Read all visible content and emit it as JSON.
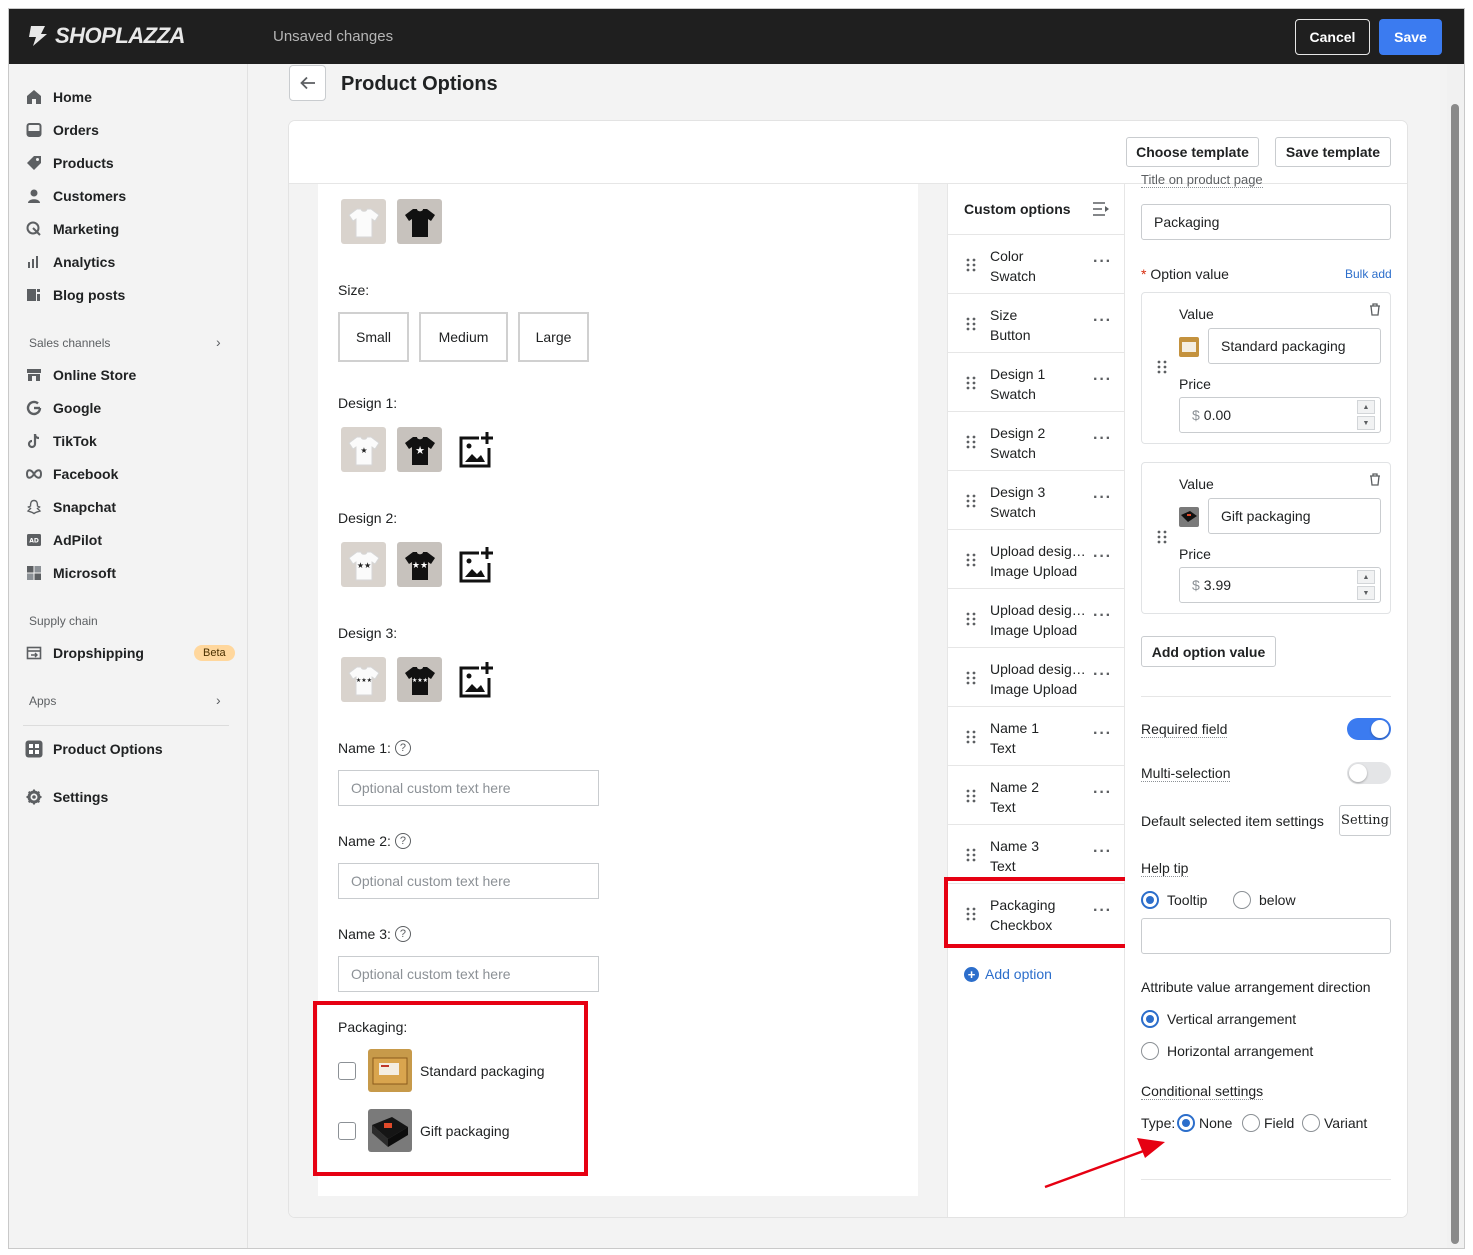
{
  "topbar": {
    "logo_text": "SHOPLAZZA",
    "status_text": "Unsaved changes",
    "cancel_label": "Cancel",
    "save_label": "Save",
    "accent_color": "#3b7bf0"
  },
  "sidebar": {
    "items": [
      {
        "label": "Home",
        "icon": "home-icon"
      },
      {
        "label": "Orders",
        "icon": "orders-icon"
      },
      {
        "label": "Products",
        "icon": "tag-icon"
      },
      {
        "label": "Customers",
        "icon": "person-icon"
      },
      {
        "label": "Marketing",
        "icon": "marketing-icon"
      },
      {
        "label": "Analytics",
        "icon": "analytics-icon"
      },
      {
        "label": "Blog posts",
        "icon": "blog-icon"
      }
    ],
    "sales_channels_label": "Sales channels",
    "channels": [
      {
        "label": "Online Store",
        "icon": "store-icon"
      },
      {
        "label": "Google",
        "icon": "google-icon"
      },
      {
        "label": "TikTok",
        "icon": "tiktok-icon"
      },
      {
        "label": "Facebook",
        "icon": "facebook-icon"
      },
      {
        "label": "Snapchat",
        "icon": "snapchat-icon"
      },
      {
        "label": "AdPilot",
        "icon": "adpilot-icon"
      },
      {
        "label": "Microsoft",
        "icon": "microsoft-icon"
      }
    ],
    "supply_chain_label": "Supply chain",
    "dropshipping_label": "Dropshipping",
    "beta_label": "Beta",
    "apps_label": "Apps",
    "product_options_label": "Product Options",
    "settings_label": "Settings"
  },
  "header": {
    "page_title": "Product Options",
    "choose_template_label": "Choose template",
    "save_template_label": "Save template"
  },
  "preview": {
    "size_label": "Size:",
    "size_options": [
      "Small",
      "Medium",
      "Large"
    ],
    "design1_label": "Design 1:",
    "design2_label": "Design 2:",
    "design3_label": "Design 3:",
    "name1_label": "Name 1:",
    "name2_label": "Name 2:",
    "name3_label": "Name 3:",
    "name_placeholder": "Optional custom text here",
    "packaging_label": "Packaging:",
    "packaging_options": [
      "Standard packaging",
      "Gift packaging"
    ]
  },
  "custom_options": {
    "title": "Custom options",
    "items": [
      {
        "name": "Color",
        "type": "Swatch"
      },
      {
        "name": "Size",
        "type": "Button"
      },
      {
        "name": "Design 1",
        "type": "Swatch"
      },
      {
        "name": "Design 2",
        "type": "Swatch"
      },
      {
        "name": "Design 3",
        "type": "Swatch"
      },
      {
        "name": "Upload design...",
        "type": "Image Upload"
      },
      {
        "name": "Upload design...",
        "type": "Image Upload"
      },
      {
        "name": "Upload design...",
        "type": "Image Upload"
      },
      {
        "name": "Name 1",
        "type": "Text"
      },
      {
        "name": "Name 2",
        "type": "Text"
      },
      {
        "name": "Name 3",
        "type": "Text"
      },
      {
        "name": "Packaging",
        "type": "Checkbox"
      }
    ],
    "add_option_label": "Add option"
  },
  "settings": {
    "title_field_label": "Title on product page",
    "title_value": "Packaging",
    "option_value_label": "Option value",
    "required_mark": "*",
    "bulk_add_label": "Bulk add",
    "value_label": "Value",
    "price_label": "Price",
    "currency_symbol": "$",
    "values": [
      {
        "value": "Standard packaging",
        "price": "0.00"
      },
      {
        "value": "Gift packaging",
        "price": "3.99"
      }
    ],
    "add_option_value_label": "Add option value",
    "required_field_label": "Required field",
    "required_field_on": true,
    "multi_selection_label": "Multi-selection",
    "multi_selection_on": false,
    "default_selected_label": "Default selected item settings",
    "setting_button_label": "Setting",
    "help_tip_label": "Help tip",
    "help_tip_options": [
      "Tooltip",
      "below"
    ],
    "help_tip_selected": "Tooltip",
    "help_tip_value": "",
    "arrangement_label": "Attribute value arrangement direction",
    "arrangement_options": [
      "Vertical arrangement",
      "Horizontal arrangement"
    ],
    "arrangement_selected": "Vertical arrangement",
    "conditional_label": "Conditional settings",
    "type_label": "Type:",
    "type_options": [
      "None",
      "Field",
      "Variant"
    ],
    "type_selected": "None"
  },
  "annotation_color": "#e60012"
}
